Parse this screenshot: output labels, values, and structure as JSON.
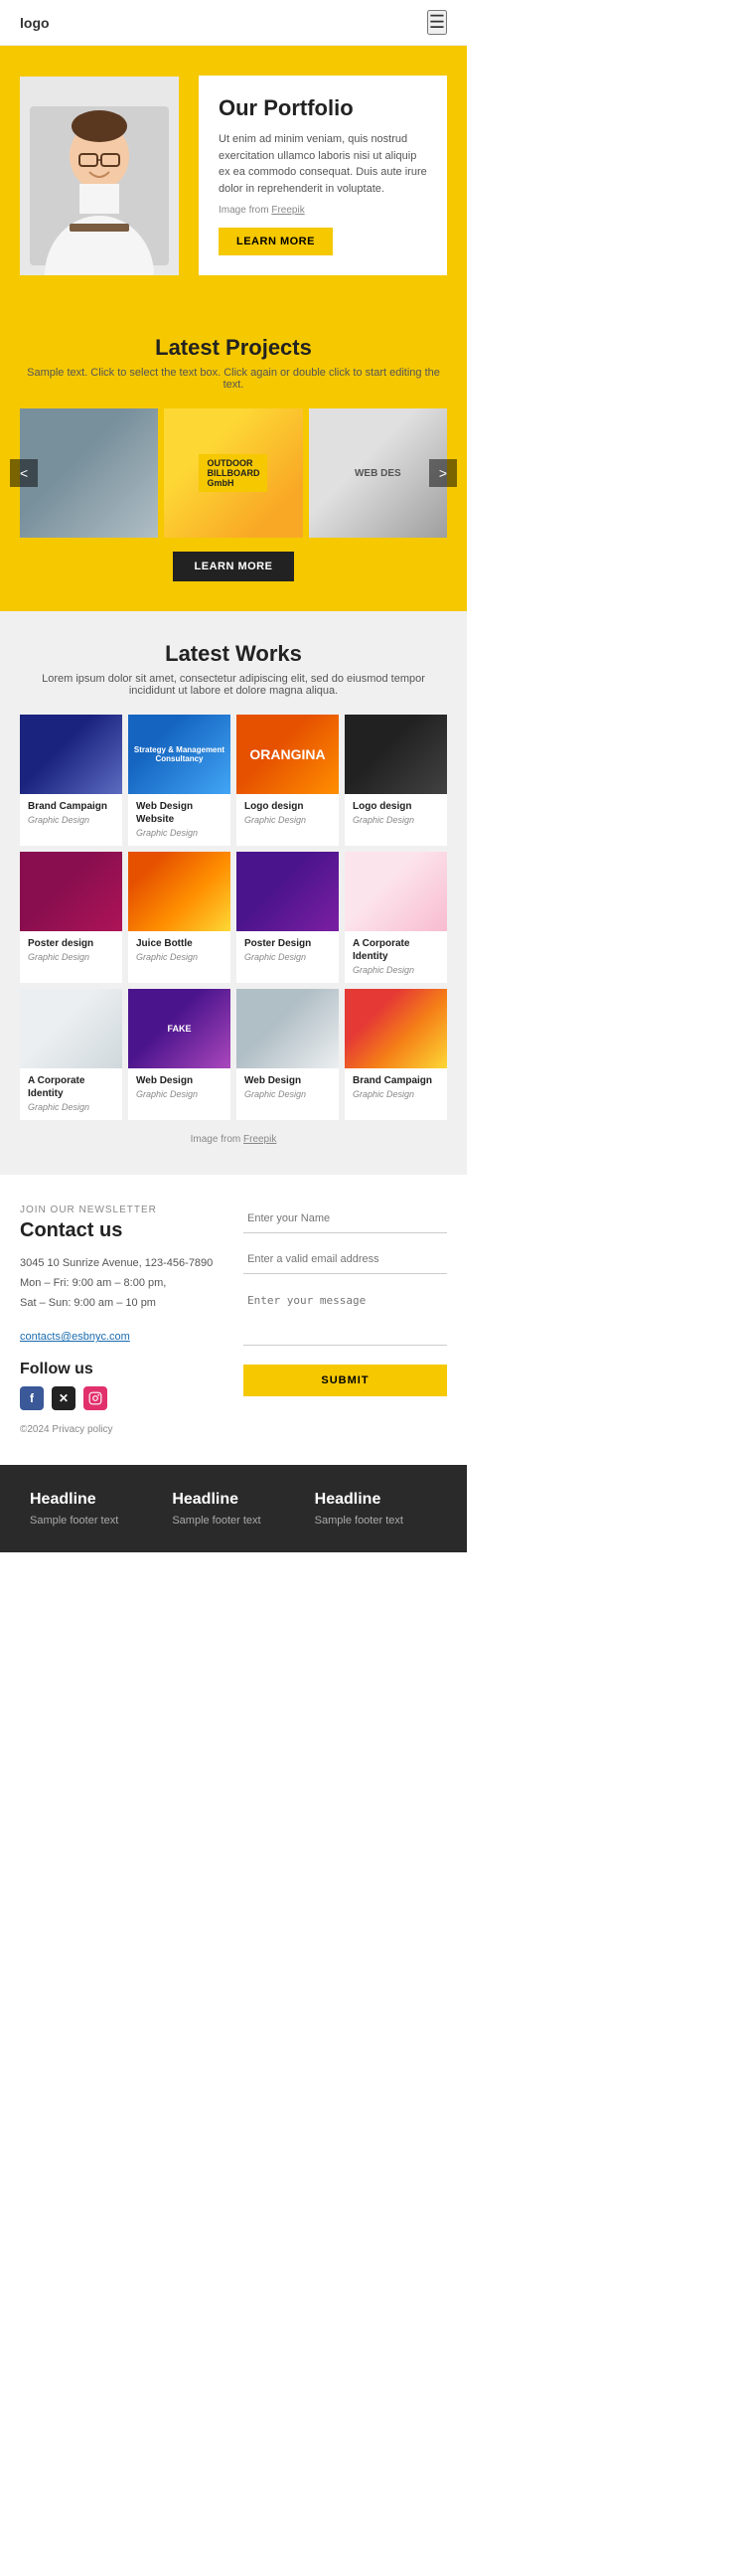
{
  "header": {
    "logo": "logo",
    "menu_icon": "☰"
  },
  "hero": {
    "title": "Our Portfolio",
    "text": "Ut enim ad minim veniam, quis nostrud exercitation ullamco laboris nisi ut aliquip ex ea commodo consequat. Duis aute irure dolor in reprehenderit in voluptate.",
    "image_credit": "Image from Freepik",
    "freepik_link": "Freepik",
    "btn_learn_more": "LEARN MORE"
  },
  "latest_projects": {
    "title": "Latest Projects",
    "subtitle": "Sample text. Click to select the text box. Click again or double click to start editing the text.",
    "btn_learn_more": "LEARN MORE",
    "carousel_nav_left": "<",
    "carousel_nav_right": ">"
  },
  "latest_works": {
    "title": "Latest Works",
    "subtitle": "Lorem ipsum dolor sit amet, consectetur adipiscing elit, sed do eiusmod tempor incididunt ut labore et dolore magna aliqua.",
    "image_credit": "Image from Freepik",
    "freepik_link": "Freepik",
    "items": [
      {
        "title": "Brand Campaign",
        "category": "Graphic Design"
      },
      {
        "title": "Web Design Website",
        "category": "Graphic Design"
      },
      {
        "title": "Logo design",
        "category": "Graphic Design"
      },
      {
        "title": "Logo design",
        "category": "Graphic Design"
      },
      {
        "title": "Poster design",
        "category": "Graphic Design"
      },
      {
        "title": "Juice Bottle",
        "category": "Graphic Design"
      },
      {
        "title": "Poster Design",
        "category": "Graphic Design"
      },
      {
        "title": "A Corporate Identity",
        "category": "Graphic Design"
      },
      {
        "title": "A Corporate Identity",
        "category": "Graphic Design"
      },
      {
        "title": "Web Design",
        "category": "Graphic Design"
      },
      {
        "title": "Web Design",
        "category": "Graphic Design"
      },
      {
        "title": "Brand Campaign",
        "category": "Graphic Design"
      }
    ]
  },
  "contact": {
    "newsletter_label": "JOIN OUR NEWSLETTER",
    "title": "Contact us",
    "address": "3045 10 Sunrize Avenue, 123-456-7890",
    "hours1": "Mon – Fri: 9:00 am – 8:00 pm,",
    "hours2": "Sat – Sun: 9:00 am – 10 pm",
    "email": "contacts@esbnyc.com",
    "follow_title": "Follow us",
    "copyright": "©2024 Privacy policy",
    "form": {
      "name_placeholder": "Enter your Name",
      "email_placeholder": "Enter a valid email address",
      "message_placeholder": "Enter your message",
      "submit_label": "SUBMIT"
    },
    "social": {
      "facebook": "f",
      "twitter": "✕",
      "instagram": "📷"
    }
  },
  "footer": {
    "columns": [
      {
        "headline": "Headline",
        "text": "Sample footer text"
      },
      {
        "headline": "Headline",
        "text": "Sample footer text"
      },
      {
        "headline": "Headline",
        "text": "Sample footer text"
      }
    ]
  }
}
